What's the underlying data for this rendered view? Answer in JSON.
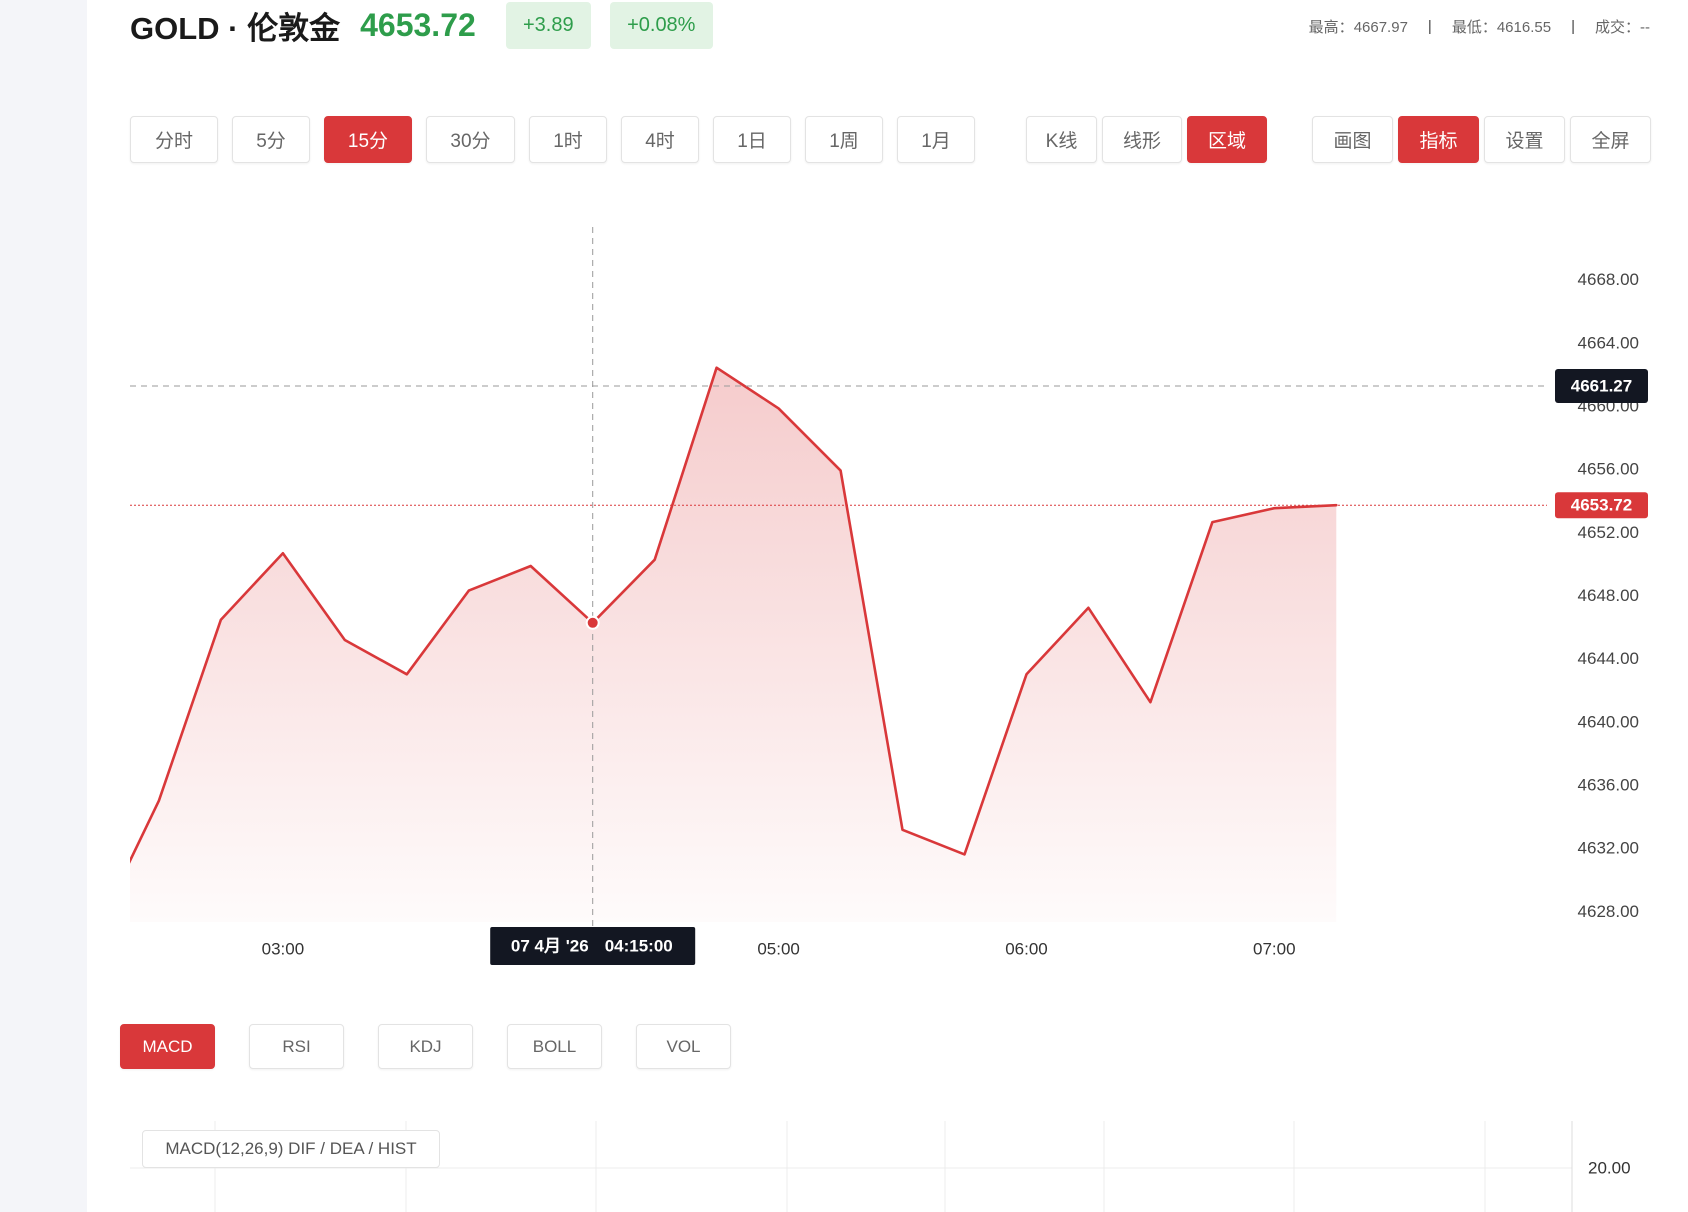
{
  "header": {
    "symbol": "GOLD · 伦敦金",
    "price": "4653.72",
    "change": "+3.89",
    "change_pct": "+0.08%",
    "stats": [
      {
        "label": "最高：",
        "value": "4667.97"
      },
      {
        "label": "最低：",
        "value": "4616.55"
      },
      {
        "label": "成交：",
        "value": "--"
      }
    ],
    "separator": "|"
  },
  "toolbar": {
    "intervals": [
      {
        "label": "分时"
      },
      {
        "label": "5分"
      },
      {
        "label": "15分",
        "active": true
      },
      {
        "label": "30分"
      },
      {
        "label": "1时"
      },
      {
        "label": "4时"
      },
      {
        "label": "1日"
      },
      {
        "label": "1周"
      },
      {
        "label": "1月"
      }
    ],
    "chart_types": [
      {
        "label": "K线"
      },
      {
        "label": "线形"
      },
      {
        "label": "区域",
        "active": true
      }
    ],
    "tools": [
      {
        "label": "画图"
      },
      {
        "label": "指标",
        "active": true
      },
      {
        "label": "设置"
      },
      {
        "label": "全屏"
      }
    ]
  },
  "indicators": {
    "tabs": [
      {
        "label": "MACD",
        "active": true
      },
      {
        "label": "RSI"
      },
      {
        "label": "KDJ"
      },
      {
        "label": "BOLL"
      },
      {
        "label": "VOL"
      }
    ],
    "macd_panel": {
      "legend": "MACD(12,26,9) DIF / DEA / HIST",
      "y_tick": "20.00"
    }
  },
  "colors": {
    "accent": "#d9383a",
    "up": "#2e9d4b",
    "up_bg": "#e2f3e4",
    "crosshair_tag": "#131722"
  },
  "chart_data": {
    "type": "area",
    "x": [
      "02:15",
      "02:30",
      "02:45",
      "03:00",
      "03:15",
      "03:30",
      "03:45",
      "04:00",
      "04:15",
      "04:30",
      "04:45",
      "05:00",
      "05:15",
      "05:30",
      "05:45",
      "06:00",
      "06:15",
      "06:30",
      "06:45",
      "07:00",
      "07:15"
    ],
    "values": [
      4626.85,
      4635.0,
      4646.47,
      4650.68,
      4645.18,
      4643.01,
      4648.31,
      4649.87,
      4646.27,
      4650.27,
      4662.43,
      4659.85,
      4655.91,
      4633.16,
      4631.6,
      4643.01,
      4647.22,
      4641.24,
      4652.65,
      4653.53,
      4653.72
    ],
    "x_ticks": [
      "03:00",
      "05:00",
      "06:00",
      "07:00"
    ],
    "y_ticks": [
      "4628.00",
      "4632.00",
      "4636.00",
      "4640.00",
      "4644.00",
      "4648.00",
      "4652.00",
      "4656.00",
      "4660.00",
      "4664.00",
      "4668.00"
    ],
    "xlim": [
      "02:23",
      "08:06"
    ],
    "ylim": [
      4627.32,
      4671.34
    ],
    "grid": false,
    "last_price": 4653.72,
    "last_price_label": "4653.72",
    "crosshair": {
      "x": "04:15",
      "y": 4661.27,
      "y_label": "4661.27",
      "date_label": "07 4月 '26",
      "time_label": "04:15:00"
    }
  }
}
